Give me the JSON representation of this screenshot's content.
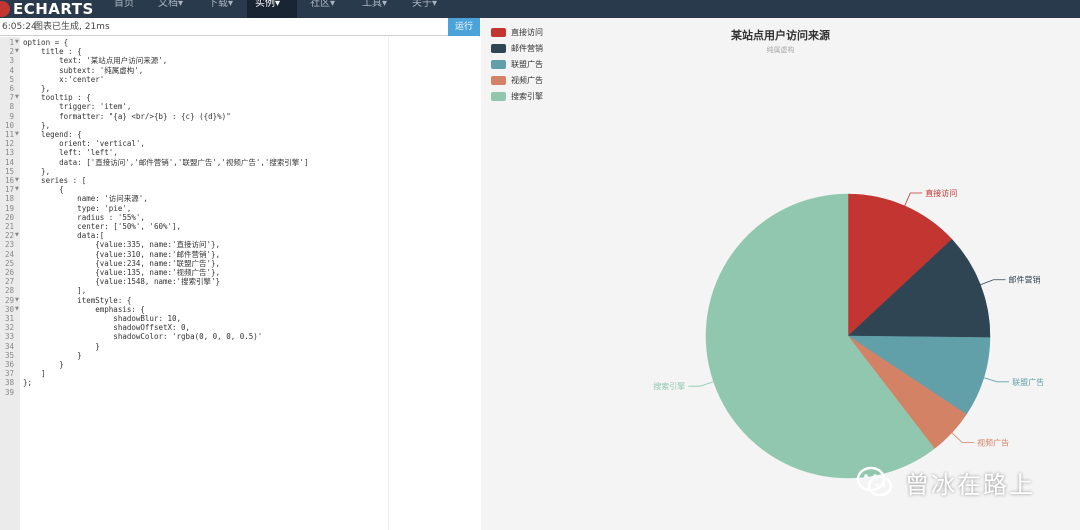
{
  "app": {
    "logo_text": "ECHARTS",
    "nav": [
      "首页",
      "文档▾",
      "下载▾",
      "实例▾",
      "社区▾",
      "工具▾",
      "关于▾"
    ],
    "active_nav_index": 3
  },
  "editor": {
    "status_time": "6:05:24",
    "status_msg": "图表已生成, 21ms",
    "run_label": "运行",
    "line_numbers": [
      "1",
      "2",
      "3",
      "4",
      "5",
      "6",
      "7",
      "8",
      "9",
      "10",
      "11",
      "12",
      "13",
      "14",
      "15",
      "16",
      "17",
      "18",
      "19",
      "20",
      "21",
      "22",
      "23",
      "24",
      "25",
      "26",
      "27",
      "28",
      "29",
      "30",
      "31",
      "32",
      "33",
      "34",
      "35",
      "36",
      "37",
      "38",
      "39"
    ],
    "fold_lines": [
      1,
      2,
      7,
      11,
      16,
      17,
      22,
      29,
      30
    ],
    "code_lines": [
      "option = {",
      "    title : {",
      "        text: '某站点用户访问来源',",
      "        subtext: '纯属虚构',",
      "        x:'center'",
      "    },",
      "    tooltip : {",
      "        trigger: 'item',",
      "        formatter: \"{a} <br/>{b} : {c} ({d}%)\"",
      "    },",
      "    legend: {",
      "        orient: 'vertical',",
      "        left: 'left',",
      "        data: ['直接访问','邮件营销','联盟广告','视频广告','搜索引擎']",
      "    },",
      "    series : [",
      "        {",
      "            name: '访问来源',",
      "            type: 'pie',",
      "            radius : '55%',",
      "            center: ['50%', '60%'],",
      "            data:[",
      "                {value:335, name:'直接访问'},",
      "                {value:310, name:'邮件营销'},",
      "                {value:234, name:'联盟广告'},",
      "                {value:135, name:'视频广告'},",
      "                {value:1548, name:'搜索引擎'}",
      "            ],",
      "            itemStyle: {",
      "                emphasis: {",
      "                    shadowBlur: 10,",
      "                    shadowOffsetX: 0,",
      "                    shadowColor: 'rgba(0, 0, 0, 0.5)'",
      "                }",
      "            }",
      "        }",
      "    ]",
      "};",
      ""
    ]
  },
  "chart_data": {
    "type": "pie",
    "title": "某站点用户访问来源",
    "subtitle": "纯属虚构",
    "legend_position": "top-left",
    "slices": [
      {
        "name": "直接访问",
        "value": 335,
        "color": "#c23531"
      },
      {
        "name": "邮件营销",
        "value": 310,
        "color": "#2f4554"
      },
      {
        "name": "联盟广告",
        "value": 234,
        "color": "#61a0a8"
      },
      {
        "name": "视频广告",
        "value": 135,
        "color": "#d48265"
      },
      {
        "name": "搜索引擎",
        "value": 1548,
        "color": "#91c7ae"
      }
    ]
  },
  "watermark": {
    "text": "曾冰在路上"
  }
}
